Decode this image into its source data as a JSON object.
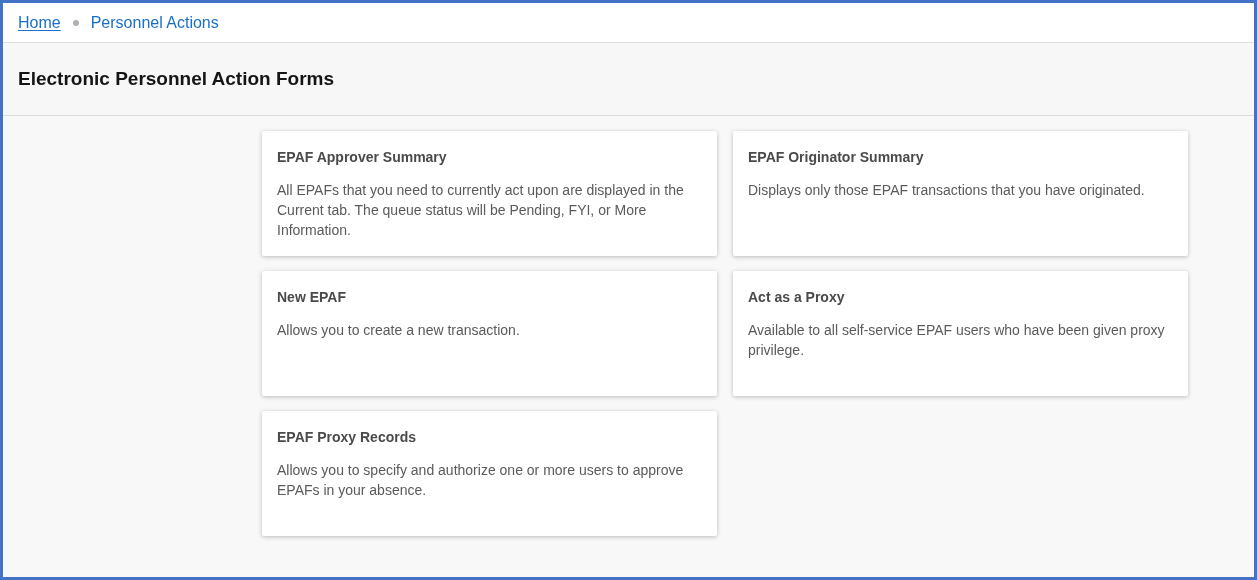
{
  "breadcrumb": [
    {
      "label": "Home",
      "kind": "link"
    },
    {
      "label": "Personnel Actions",
      "kind": "current"
    }
  ],
  "page_title": "Electronic Personnel Action Forms",
  "cards": [
    {
      "title": "EPAF Approver Summary",
      "description": "All EPAFs that you need to currently act upon are displayed in the Current tab. The queue status will be Pending, FYI, or More Information."
    },
    {
      "title": "EPAF Originator Summary",
      "description": "Displays only those EPAF transactions that you have originated."
    },
    {
      "title": "New EPAF",
      "description": "Allows you to create a new transaction."
    },
    {
      "title": "Act as a Proxy",
      "description": "Available to all self-service EPAF users who have been given proxy privilege."
    },
    {
      "title": "EPAF Proxy Records",
      "description": "Allows you to specify and authorize one or more users to approve EPAFs in your absence."
    }
  ]
}
